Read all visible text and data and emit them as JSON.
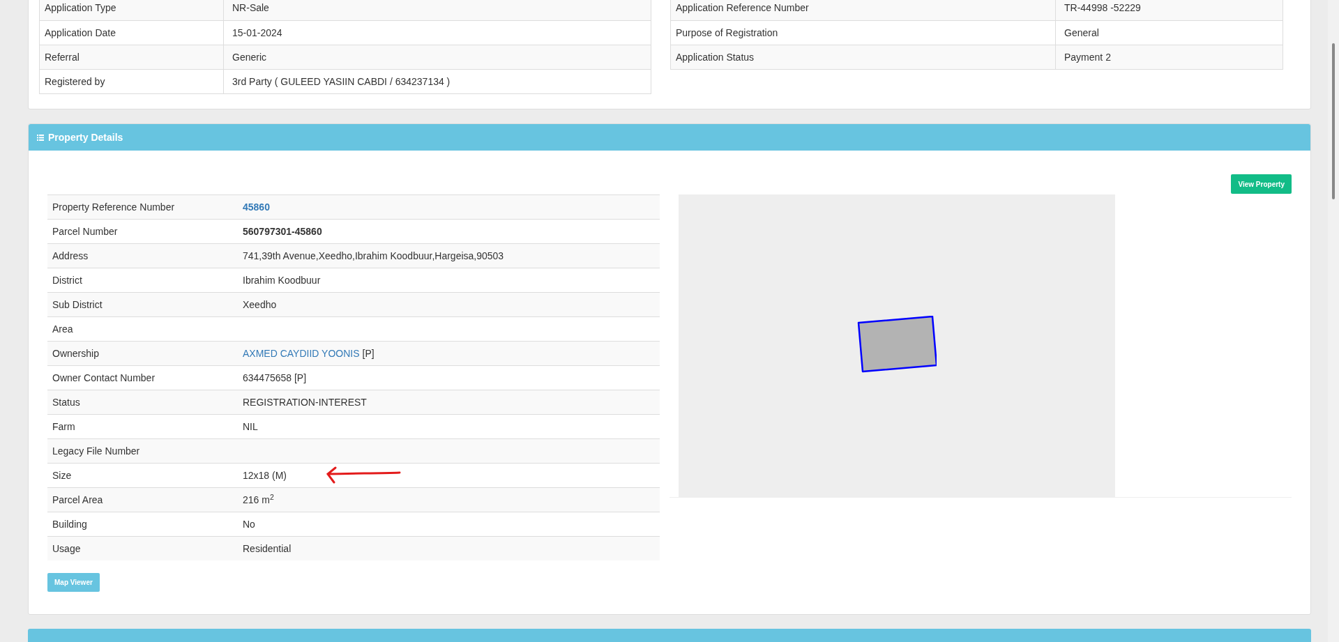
{
  "application": {
    "left_rows": [
      {
        "label": "Application Type",
        "value": "NR-Sale"
      },
      {
        "label": "Application Date",
        "value": "15-01-2024"
      },
      {
        "label": "Referral",
        "value": "Generic"
      },
      {
        "label": "Registered by",
        "value": "3rd Party ( GULEED YASIIN CABDI / 634237134 )"
      }
    ],
    "right_rows": [
      {
        "label": "Application Reference Number",
        "value": "TR-44998 -52229"
      },
      {
        "label": "Purpose of Registration",
        "value": "General"
      },
      {
        "label": "Application Status",
        "value": "Payment 2"
      }
    ]
  },
  "property": {
    "title": "Property Details",
    "view_button": "View Property",
    "map_button": "Map Viewer",
    "rows": [
      {
        "label": "Property Reference Number",
        "kind": "bold_link",
        "value": "45860"
      },
      {
        "label": "Parcel Number",
        "kind": "bold",
        "value": "560797301-45860"
      },
      {
        "label": "Address",
        "kind": "text",
        "value": "741,39th Avenue,Xeedho,Ibrahim Koodbuur,Hargeisa,90503"
      },
      {
        "label": "District",
        "kind": "text",
        "value": "Ibrahim Koodbuur"
      },
      {
        "label": "Sub District",
        "kind": "text",
        "value": "Xeedho"
      },
      {
        "label": "Area",
        "kind": "text"
      },
      {
        "label": "Ownership",
        "kind": "link",
        "value": "AXMED CAYDIID YOONIS",
        "suffix": "[P]"
      },
      {
        "label": "Owner Contact Number",
        "kind": "text",
        "value": "634475658 [P]"
      },
      {
        "label": "Status",
        "kind": "text",
        "value": "REGISTRATION-INTEREST"
      },
      {
        "label": "Farm",
        "kind": "text",
        "value": "NIL"
      },
      {
        "label": "Legacy File Number",
        "kind": "text"
      },
      {
        "label": "Size",
        "kind": "text",
        "value": "12x18 (M)",
        "annotated": true
      },
      {
        "label": "Parcel Area",
        "kind": "text",
        "value": "216 m$^{2}$"
      },
      {
        "label": "Building",
        "kind": "text",
        "value": "No"
      },
      {
        "label": "Usage",
        "kind": "text",
        "value": "Residential"
      }
    ]
  }
}
